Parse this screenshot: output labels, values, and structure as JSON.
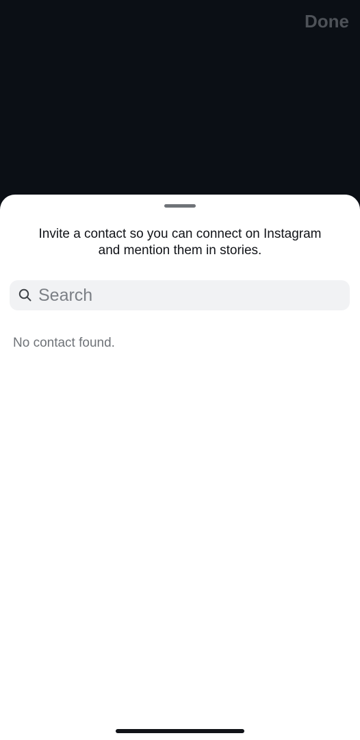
{
  "header": {
    "done_label": "Done"
  },
  "sheet": {
    "intro_text": "Invite a contact so you can connect on Instagram and mention them in stories.",
    "search": {
      "value": "",
      "placeholder": "Search"
    },
    "empty_state": "No contact found."
  },
  "icons": {
    "search": "search-icon"
  },
  "colors": {
    "backdrop": "#0b0f15",
    "sheet_background": "#ffffff",
    "search_background": "#f1f2f4",
    "muted_text": "#6f7378",
    "done_text": "#4e5258"
  }
}
